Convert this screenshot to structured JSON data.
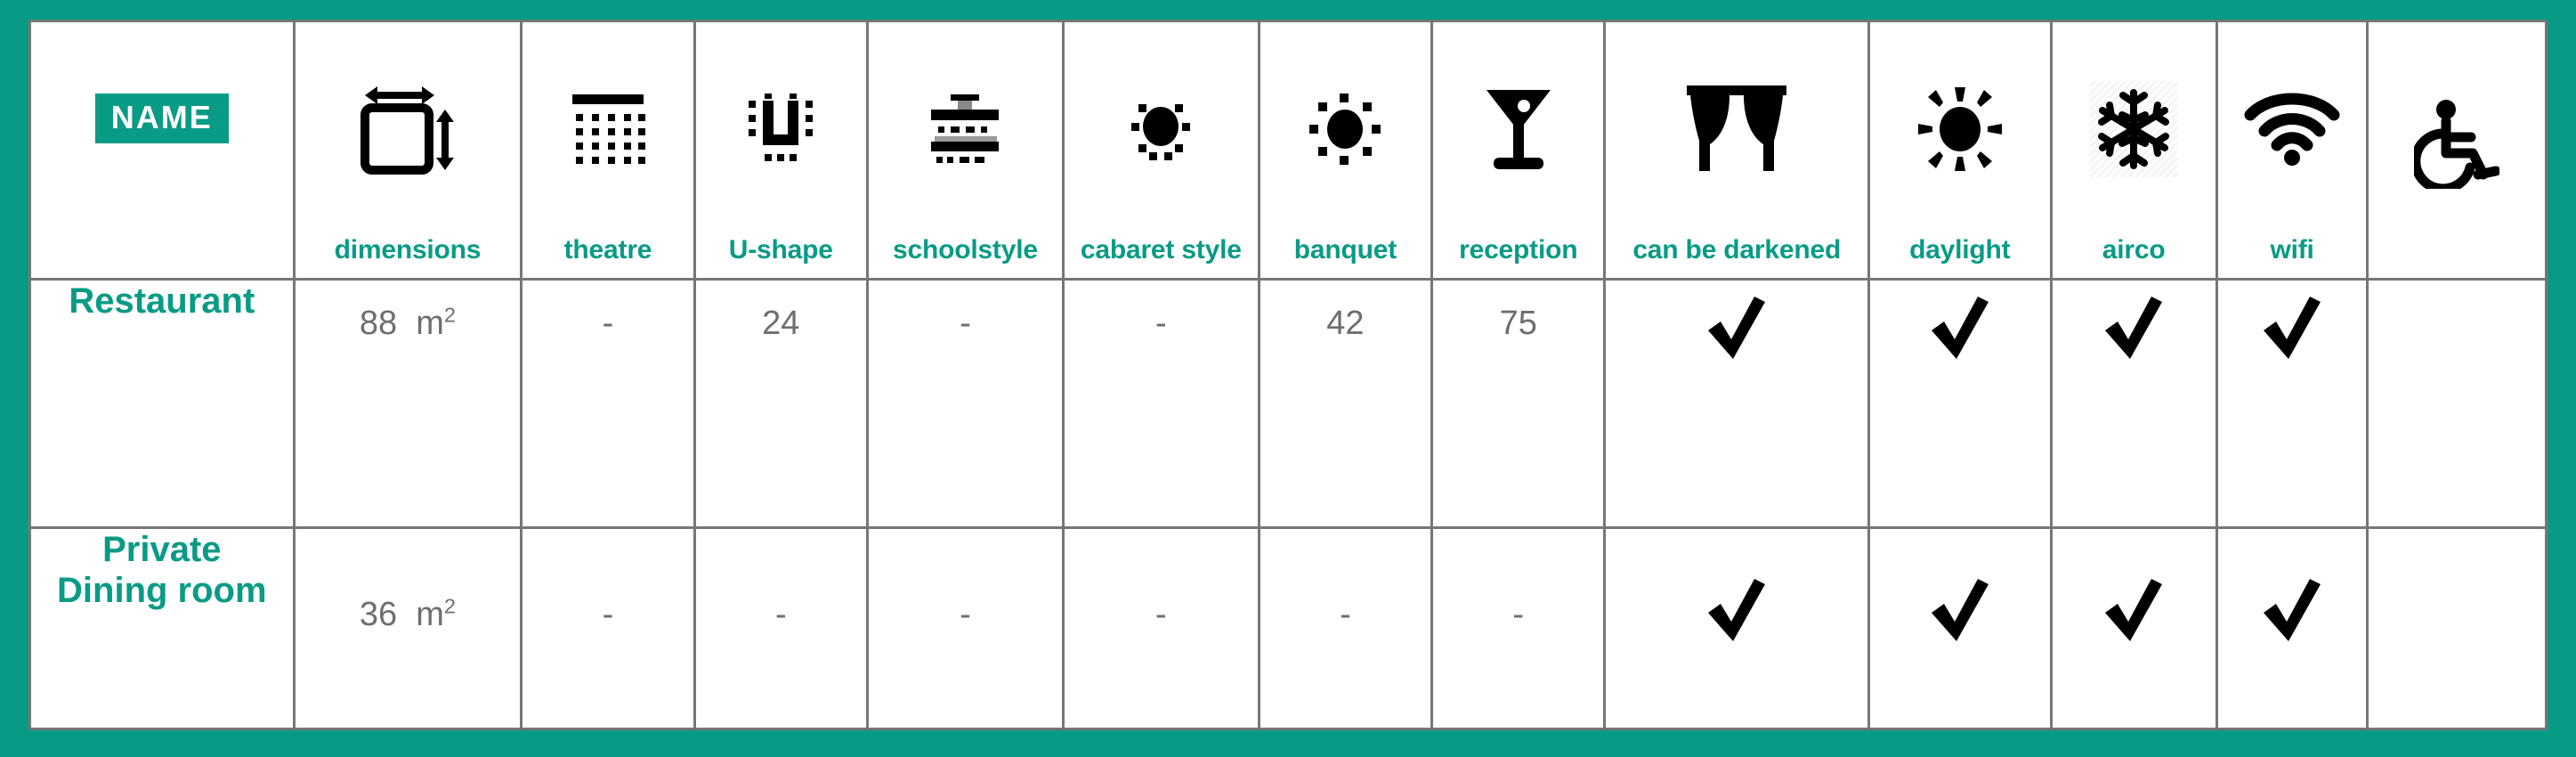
{
  "colors": {
    "teal": "#089b86",
    "grid": "#767676",
    "value_gray": "#6e6e6e",
    "icon_black": "#000000",
    "page_background": "#079b86"
  },
  "table": {
    "name_badge_label": "NAME",
    "columns": [
      {
        "key": "name",
        "label": "NAME",
        "icon": "name-badge",
        "has_label": false
      },
      {
        "key": "dimensions",
        "label": "dimensions",
        "icon": "dimensions-icon",
        "has_label": true
      },
      {
        "key": "theatre",
        "label": "theatre",
        "icon": "theatre-icon",
        "has_label": true
      },
      {
        "key": "ushape",
        "label": "U-shape",
        "icon": "u-shape-icon",
        "has_label": true
      },
      {
        "key": "schoolstyle",
        "label": "schoolstyle",
        "icon": "schoolstyle-icon",
        "has_label": true
      },
      {
        "key": "cabaret",
        "label": "cabaret style",
        "icon": "cabaret-style-icon",
        "has_label": true
      },
      {
        "key": "banquet",
        "label": "banquet",
        "icon": "banquet-icon",
        "has_label": true
      },
      {
        "key": "reception",
        "label": "reception",
        "icon": "cocktail-glass-icon",
        "has_label": true
      },
      {
        "key": "darkened",
        "label": "can be darkened",
        "icon": "curtain-icon",
        "has_label": true
      },
      {
        "key": "daylight",
        "label": "daylight",
        "icon": "sun-icon",
        "has_label": true
      },
      {
        "key": "airco",
        "label": "airco",
        "icon": "snowflake-icon",
        "has_label": true
      },
      {
        "key": "wifi",
        "label": "wifi",
        "icon": "wifi-icon",
        "has_label": true
      },
      {
        "key": "accessible",
        "label": "",
        "icon": "wheelchair-icon",
        "has_label": false
      }
    ],
    "rows": [
      {
        "name": "Restaurant",
        "dimensions_value": "88",
        "dimensions_unit": "m",
        "dimensions_exponent": "2",
        "theatre": "-",
        "ushape": "24",
        "schoolstyle": "-",
        "cabaret": "-",
        "banquet": "42",
        "reception": "75",
        "darkened": "check",
        "daylight": "check",
        "airco": "check",
        "wifi": "check",
        "accessible": ""
      },
      {
        "name": "Private Dining room",
        "dimensions_value": "36",
        "dimensions_unit": "m",
        "dimensions_exponent": "2",
        "theatre": "-",
        "ushape": "-",
        "schoolstyle": "-",
        "cabaret": "-",
        "banquet": "-",
        "reception": "-",
        "darkened": "check",
        "daylight": "check",
        "airco": "check",
        "wifi": "check",
        "accessible": ""
      }
    ]
  }
}
